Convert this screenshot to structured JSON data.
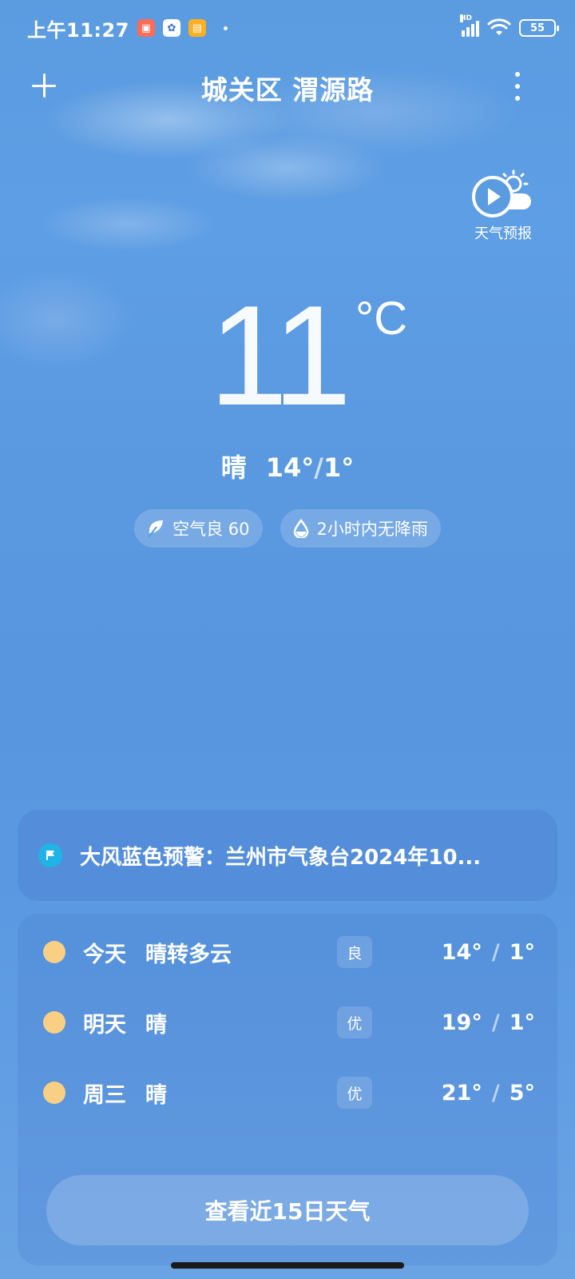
{
  "status_bar": {
    "time": "上午11:27",
    "network_label": "HD",
    "battery": "55"
  },
  "header": {
    "location": "城关区 渭源路"
  },
  "forecast_video": {
    "label": "天气预报"
  },
  "current": {
    "temperature": "11",
    "unit": "°C",
    "condition": "晴",
    "high": "14°",
    "low": "1°",
    "air_quality": "空气良 60",
    "precipitation": "2小时内无降雨"
  },
  "alert": {
    "text": "大风蓝色预警：兰州市气象台2024年10..."
  },
  "daily": [
    {
      "day": "今天",
      "condition": "晴转多云",
      "aqi": "良",
      "high": "14°",
      "low": "1°"
    },
    {
      "day": "明天",
      "condition": "晴",
      "aqi": "优",
      "high": "19°",
      "low": "1°"
    },
    {
      "day": "周三",
      "condition": "晴",
      "aqi": "优",
      "high": "21°",
      "low": "5°"
    }
  ],
  "more_days_button": "查看近15日天气",
  "colors": {
    "sky_top": "#5b9be0",
    "sky_bottom": "#6aa4e4",
    "sun_icon": "#f9cf84",
    "alert_icon": "#1fb3e8"
  }
}
